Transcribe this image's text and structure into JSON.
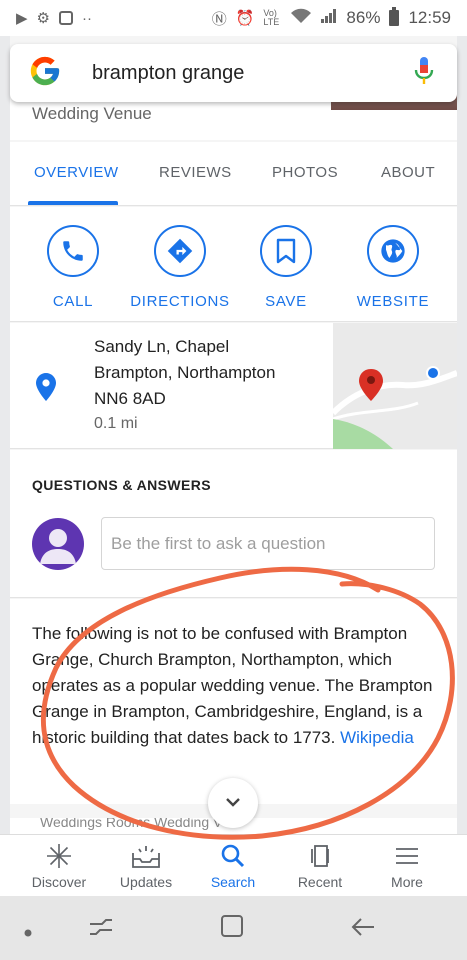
{
  "status_bar": {
    "battery_percent": "86%",
    "time": "12:59",
    "dots": "··",
    "volte_label": "Vo) LTE"
  },
  "search": {
    "query": "brampton grange"
  },
  "place": {
    "type": "Wedding Venue"
  },
  "tabs": [
    {
      "label": "OVERVIEW",
      "active": true
    },
    {
      "label": "REVIEWS",
      "active": false
    },
    {
      "label": "PHOTOS",
      "active": false
    },
    {
      "label": "ABOUT",
      "active": false
    }
  ],
  "actions": [
    {
      "label": "CALL",
      "icon": "phone-icon"
    },
    {
      "label": "DIRECTIONS",
      "icon": "directions-icon"
    },
    {
      "label": "SAVE",
      "icon": "bookmark-icon"
    },
    {
      "label": "WEBSITE",
      "icon": "globe-icon"
    }
  ],
  "address": {
    "line1": "Sandy Ln, Chapel",
    "line2": "Brampton, Northampton",
    "line3": "NN6 8AD",
    "distance": "0.1 mi"
  },
  "qa": {
    "title": "QUESTIONS & ANSWERS",
    "placeholder": "Be the first to ask a question"
  },
  "description": {
    "text": "The following is not to be confused with Brampton Grange, Church Brampton, Northampton, which operates as a popular wedding venue. The Brampton Grange in Brampton, Cambridgeshire, England, is a historic building that dates back to 1773.",
    "source_link": "Wikipedia"
  },
  "next_section_peek": "Weddings Rooms Wedding V",
  "bottom_nav": [
    {
      "label": "Discover",
      "icon": "asterisk-icon",
      "active": false
    },
    {
      "label": "Updates",
      "icon": "updates-tray-icon",
      "active": false
    },
    {
      "label": "Search",
      "icon": "search-icon",
      "active": true
    },
    {
      "label": "Recent",
      "icon": "recent-cards-icon",
      "active": false
    },
    {
      "label": "More",
      "icon": "menu-icon",
      "active": false
    }
  ],
  "colors": {
    "accent": "#1a73e8",
    "annotation": "#ee6a45",
    "avatar": "#5e35b1",
    "map_pin": "#d93025"
  }
}
